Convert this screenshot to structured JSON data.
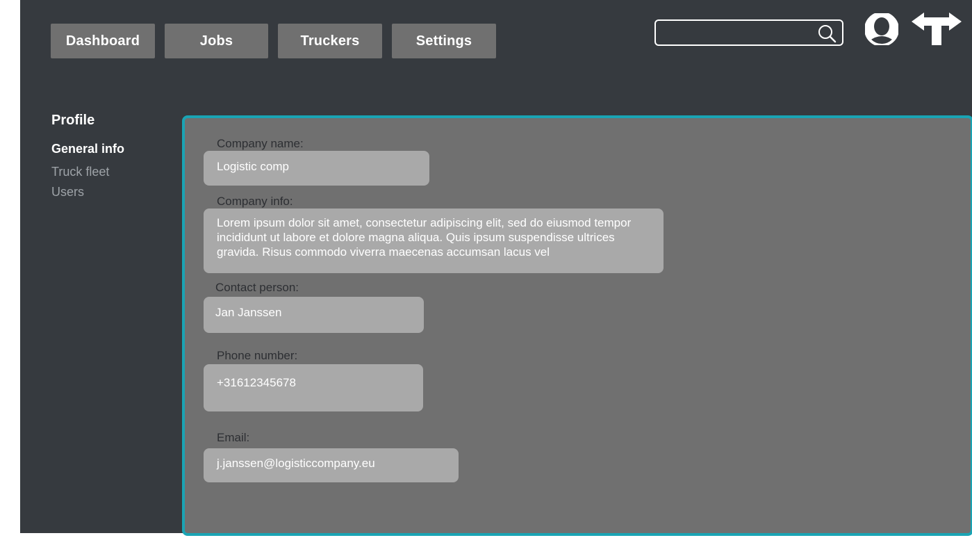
{
  "nav": {
    "items": [
      {
        "label": "Dashboard"
      },
      {
        "label": "Jobs"
      },
      {
        "label": "Truckers"
      },
      {
        "label": "Settings"
      }
    ]
  },
  "search": {
    "value": "",
    "placeholder": "",
    "icon": "search-icon"
  },
  "header_icons": {
    "avatar": "user-avatar-icon",
    "logout": "signpost-icon"
  },
  "sidebar": {
    "title": "Profile",
    "items": [
      {
        "label": "General info",
        "active": true
      },
      {
        "label": "Truck fleet",
        "active": false
      },
      {
        "label": "Users",
        "active": false
      }
    ]
  },
  "form": {
    "company_name": {
      "label": "Company name:",
      "value": "Logistic comp"
    },
    "company_info": {
      "label": "Company info:",
      "value": "Lorem ipsum dolor sit amet, consectetur adipiscing elit, sed do eiusmod tempor incididunt ut labore et dolore magna aliqua. Quis ipsum suspendisse ultrices gravida. Risus commodo viverra maecenas accumsan lacus vel"
    },
    "contact_person": {
      "label": "Contact person:",
      "value": "Jan Janssen"
    },
    "phone": {
      "label": "Phone number:",
      "value": "+31612345678"
    },
    "email": {
      "label": "Email:",
      "value": "j.janssen@logisticcompany.eu"
    }
  },
  "colors": {
    "background": "#363a3f",
    "button": "#707070",
    "panel": "#707070",
    "panel_border": "#1aa4b4",
    "field": "#a9a9a9"
  }
}
